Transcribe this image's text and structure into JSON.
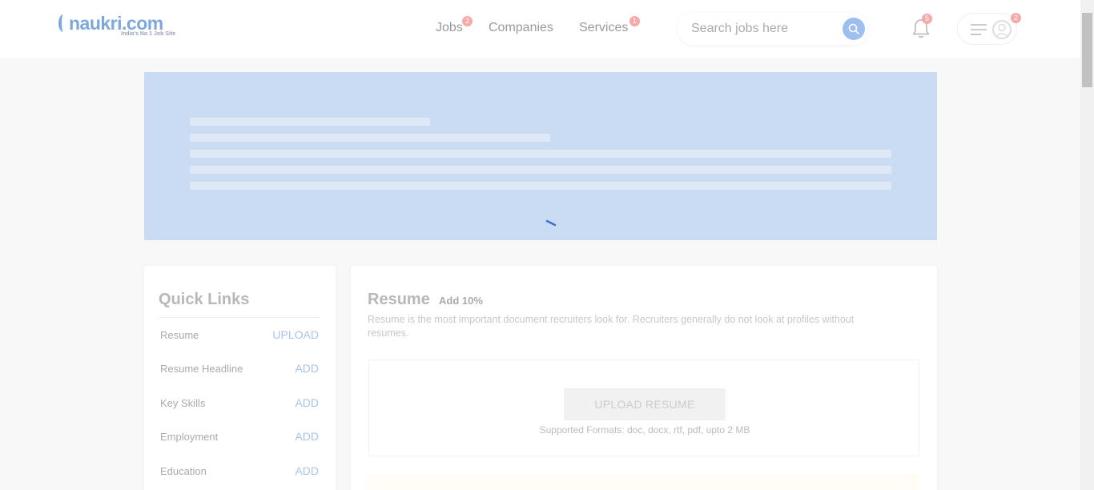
{
  "brand": {
    "logo_text": "naukri.com",
    "tagline": "India's No 1 Job Site",
    "color": "#7ea8dc"
  },
  "nav": {
    "items": [
      {
        "label": "Jobs",
        "badge": "2"
      },
      {
        "label": "Companies",
        "badge": null
      },
      {
        "label": "Services",
        "badge": "1"
      }
    ]
  },
  "search": {
    "placeholder": "Search jobs here",
    "icon": "search-icon"
  },
  "notifications": {
    "icon": "bell-icon",
    "badge": "5"
  },
  "profile": {
    "menu_icon": "hamburger-icon",
    "avatar_icon": "user-avatar-icon",
    "badge": "2"
  },
  "banner": {
    "state": "loading",
    "skeleton_lines": 5,
    "color": "#c9dcf3"
  },
  "quick_links": {
    "title": "Quick Links",
    "items": [
      {
        "label": "Resume",
        "action": "UPLOAD"
      },
      {
        "label": "Resume Headline",
        "action": "ADD"
      },
      {
        "label": "Key Skills",
        "action": "ADD"
      },
      {
        "label": "Employment",
        "action": "ADD"
      },
      {
        "label": "Education",
        "action": "ADD"
      }
    ]
  },
  "resume": {
    "title": "Resume",
    "add_percent": "Add 10%",
    "description": "Resume is the most important document recruiters look for. Recruiters generally do not look at profiles without resumes.",
    "upload_label": "UPLOAD RESUME",
    "formats": "Supported Formats: doc, docx, rtf, pdf, upto 2 MB"
  }
}
